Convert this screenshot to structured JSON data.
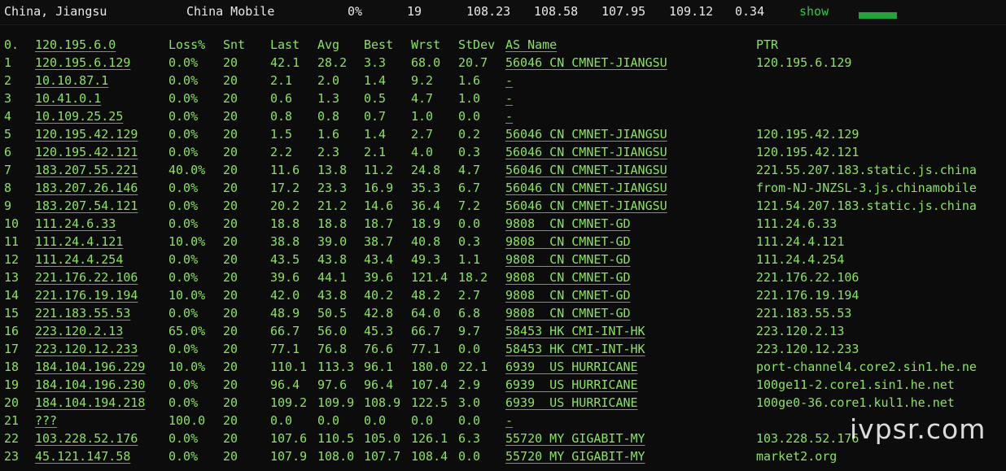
{
  "top_bar": {
    "location": "China, Jiangsu",
    "isp": "China Mobile",
    "loss": "0%",
    "hops": "19",
    "last": "108.23",
    "avg": "108.58",
    "best": "107.95",
    "worst": "109.12",
    "stdev": "0.34",
    "show_label": "show",
    "bar_color": "#1fa33a"
  },
  "columns": [
    "0.",
    "120.195.6.0",
    "Loss%",
    "Snt",
    "Last",
    "Avg",
    "Best",
    "Wrst",
    "StDev",
    "AS Name",
    "PTR"
  ],
  "rows": [
    [
      "1",
      "120.195.6.129",
      "0.0%",
      "20",
      "42.1",
      "28.2",
      "3.3",
      "68.0",
      "20.7",
      "56046 CN CMNET-JIANGSU",
      "120.195.6.129"
    ],
    [
      "2",
      "10.10.87.1",
      "0.0%",
      "20",
      "2.1",
      "2.0",
      "1.4",
      "9.2",
      "1.6",
      "-",
      ""
    ],
    [
      "3",
      "10.41.0.1",
      "0.0%",
      "20",
      "0.6",
      "1.3",
      "0.5",
      "4.7",
      "1.0",
      "-",
      ""
    ],
    [
      "4",
      "10.109.25.25",
      "0.0%",
      "20",
      "0.8",
      "0.8",
      "0.7",
      "1.0",
      "0.0",
      "-",
      ""
    ],
    [
      "5",
      "120.195.42.129",
      "0.0%",
      "20",
      "1.5",
      "1.6",
      "1.4",
      "2.7",
      "0.2",
      "56046 CN CMNET-JIANGSU",
      "120.195.42.129"
    ],
    [
      "6",
      "120.195.42.121",
      "0.0%",
      "20",
      "2.2",
      "2.3",
      "2.1",
      "4.0",
      "0.3",
      "56046 CN CMNET-JIANGSU",
      "120.195.42.121"
    ],
    [
      "7",
      "183.207.55.221",
      "40.0%",
      "20",
      "11.6",
      "13.8",
      "11.2",
      "24.8",
      "4.7",
      "56046 CN CMNET-JIANGSU",
      "221.55.207.183.static.js.china"
    ],
    [
      "8",
      "183.207.26.146",
      "0.0%",
      "20",
      "17.2",
      "23.3",
      "16.9",
      "35.3",
      "6.7",
      "56046 CN CMNET-JIANGSU",
      "from-NJ-JNZSL-3.js.chinamobile"
    ],
    [
      "9",
      "183.207.54.121",
      "0.0%",
      "20",
      "20.2",
      "21.2",
      "14.6",
      "36.4",
      "7.2",
      "56046 CN CMNET-JIANGSU",
      "121.54.207.183.static.js.china"
    ],
    [
      "10",
      "111.24.6.33",
      "0.0%",
      "20",
      "18.8",
      "18.8",
      "18.7",
      "18.9",
      "0.0",
      "9808  CN CMNET-GD",
      "111.24.6.33"
    ],
    [
      "11",
      "111.24.4.121",
      "10.0%",
      "20",
      "38.8",
      "39.0",
      "38.7",
      "40.8",
      "0.3",
      "9808  CN CMNET-GD",
      "111.24.4.121"
    ],
    [
      "12",
      "111.24.4.254",
      "0.0%",
      "20",
      "43.5",
      "43.8",
      "43.4",
      "49.3",
      "1.1",
      "9808  CN CMNET-GD",
      "111.24.4.254"
    ],
    [
      "13",
      "221.176.22.106",
      "0.0%",
      "20",
      "39.6",
      "44.1",
      "39.6",
      "121.4",
      "18.2",
      "9808  CN CMNET-GD",
      "221.176.22.106"
    ],
    [
      "14",
      "221.176.19.194",
      "10.0%",
      "20",
      "42.0",
      "43.8",
      "40.2",
      "48.2",
      "2.7",
      "9808  CN CMNET-GD",
      "221.176.19.194"
    ],
    [
      "15",
      "221.183.55.53",
      "0.0%",
      "20",
      "48.9",
      "50.5",
      "42.8",
      "64.0",
      "6.8",
      "9808  CN CMNET-GD",
      "221.183.55.53"
    ],
    [
      "16",
      "223.120.2.13",
      "65.0%",
      "20",
      "66.7",
      "56.0",
      "45.3",
      "66.7",
      "9.7",
      "58453 HK CMI-INT-HK",
      "223.120.2.13"
    ],
    [
      "17",
      "223.120.12.233",
      "0.0%",
      "20",
      "77.1",
      "76.8",
      "76.6",
      "77.1",
      "0.0",
      "58453 HK CMI-INT-HK",
      "223.120.12.233"
    ],
    [
      "18",
      "184.104.196.229",
      "10.0%",
      "20",
      "110.1",
      "113.3",
      "96.1",
      "180.0",
      "22.1",
      "6939  US HURRICANE",
      "port-channel4.core2.sin1.he.ne"
    ],
    [
      "19",
      "184.104.196.230",
      "0.0%",
      "20",
      "96.4",
      "97.6",
      "96.4",
      "107.4",
      "2.9",
      "6939  US HURRICANE",
      "100ge11-2.core1.sin1.he.net"
    ],
    [
      "20",
      "184.104.194.218",
      "0.0%",
      "20",
      "109.2",
      "109.9",
      "108.9",
      "122.5",
      "3.0",
      "6939  US HURRICANE",
      "100ge0-36.core1.kul1.he.net"
    ],
    [
      "21",
      "???",
      "100.0",
      "20",
      "0.0",
      "0.0",
      "0.0",
      "0.0",
      "0.0",
      "-",
      ""
    ],
    [
      "22",
      "103.228.52.176",
      "0.0%",
      "20",
      "107.6",
      "110.5",
      "105.0",
      "126.1",
      "6.3",
      "55720 MY GIGABIT-MY",
      "103.228.52.176"
    ],
    [
      "23",
      "45.121.147.58",
      "0.0%",
      "20",
      "107.9",
      "108.0",
      "107.7",
      "108.4",
      "0.0",
      "55720 MY GIGABIT-MY",
      "market2.org"
    ]
  ],
  "watermark": "ivpsr.com"
}
